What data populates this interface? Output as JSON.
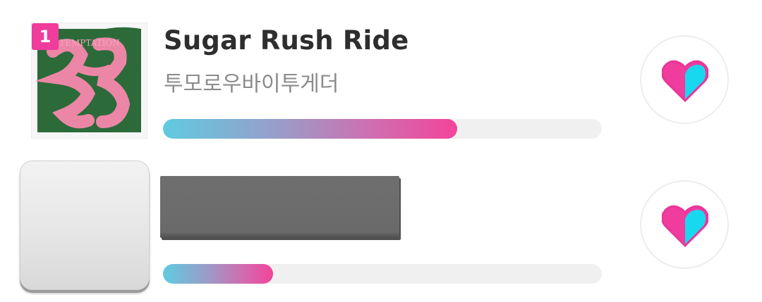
{
  "chart_list": {
    "items": [
      {
        "rank": "1",
        "title": "Sugar Rush Ride",
        "artist": "투모로우바이투게더",
        "album_art_text": "TEMPTATION",
        "popularity_fraction": 0.67,
        "like_icon": "heart-icon"
      },
      {
        "rank": "",
        "title": "",
        "artist": "",
        "popularity_fraction": 0.25,
        "like_icon": "heart-icon",
        "loading": true
      }
    ]
  },
  "colors": {
    "rank_badge": "#f03c9c",
    "bar_start": "#5fcbe0",
    "bar_end": "#f2449a",
    "heart_pink": "#f03c9c",
    "heart_cyan": "#18d8f0",
    "track": "#f0f0f0"
  }
}
